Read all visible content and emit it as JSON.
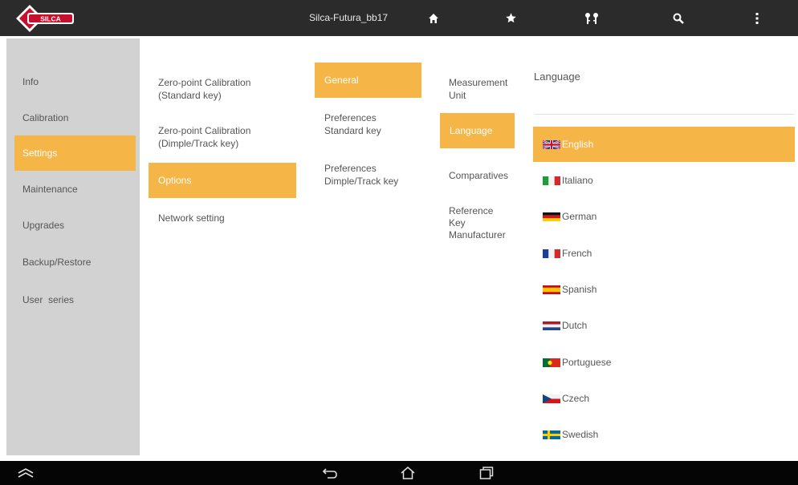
{
  "topbar": {
    "title": "Silca-Futura_bb17",
    "logo_text": "SILCA",
    "icons": [
      "home-icon",
      "star-icon",
      "keys-icon",
      "search-icon",
      "more-vertical-icon"
    ]
  },
  "sidebar": {
    "items": [
      {
        "label": "Info"
      },
      {
        "label": "Calibration"
      },
      {
        "label": "Settings"
      },
      {
        "label": "Maintenance"
      },
      {
        "label": "Upgrades"
      },
      {
        "label": "Backup/Restore"
      },
      {
        "label": "User  series"
      }
    ],
    "selected": "Settings"
  },
  "settings_menu": {
    "items": [
      {
        "label": "Zero-point Calibration\n(Standard key)"
      },
      {
        "label": "Zero-point Calibration\n(Dimple/Track key)"
      },
      {
        "label": "Options"
      },
      {
        "label": "Network setting"
      }
    ],
    "selected": "Options"
  },
  "options_menu": {
    "items": [
      {
        "label": "General"
      },
      {
        "label": "Preferences\nStandard key"
      },
      {
        "label": "Preferences\nDimple/Track key"
      }
    ],
    "selected": "General"
  },
  "general_menu": {
    "items": [
      {
        "label": "Measurement\nUnit"
      },
      {
        "label": "Language"
      },
      {
        "label": "Comparatives"
      },
      {
        "label": "Reference\nKey\nManufacturer"
      }
    ],
    "selected": "Language"
  },
  "language_panel": {
    "header": "Language",
    "selected": "English",
    "languages": [
      {
        "label": "English",
        "flag": "uk-flag"
      },
      {
        "label": "Italiano",
        "flag": "italy-flag"
      },
      {
        "label": "German",
        "flag": "germany-flag"
      },
      {
        "label": "French",
        "flag": "france-flag"
      },
      {
        "label": "Spanish",
        "flag": "spain-flag"
      },
      {
        "label": "Dutch",
        "flag": "netherlands-flag"
      },
      {
        "label": "Portuguese",
        "flag": "portugal-flag"
      },
      {
        "label": "Czech",
        "flag": "czech-flag"
      },
      {
        "label": "Swedish",
        "flag": "sweden-flag"
      }
    ]
  },
  "bottombar": {
    "icons": [
      "collapse-icon",
      "back-icon",
      "home-outline-icon",
      "recent-apps-icon"
    ]
  },
  "colors": {
    "accent": "#f6b547",
    "topbar": "#2b2b2b",
    "sidebar": "#d2d2d2",
    "bottombar": "#050505",
    "brand_red": "#c8102e"
  }
}
